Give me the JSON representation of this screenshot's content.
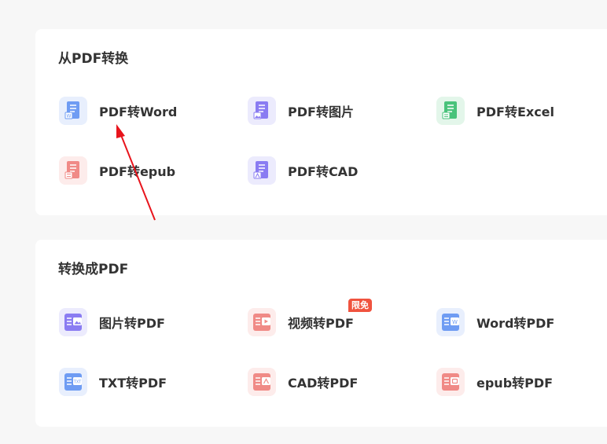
{
  "sections": [
    {
      "title": "从PDF转换",
      "tools": [
        {
          "label": "PDF转Word",
          "icon": "word-doc-icon",
          "color": "#6f9cf3",
          "bg": "#e8effd"
        },
        {
          "label": "PDF转图片",
          "icon": "image-doc-icon",
          "color": "#8a7cf2",
          "bg": "#ecebfd"
        },
        {
          "label": "PDF转Excel",
          "icon": "excel-doc-icon",
          "color": "#49c37b",
          "bg": "#e3f6ea"
        },
        {
          "label": "PDF转epub",
          "icon": "epub-doc-icon",
          "color": "#f08a86",
          "bg": "#fdeceb"
        },
        {
          "label": "PDF转CAD",
          "icon": "cad-doc-icon",
          "color": "#8a7cf2",
          "bg": "#ecebfd"
        }
      ]
    },
    {
      "title": "转换成PDF",
      "tools": [
        {
          "label": "图片转PDF",
          "icon": "image-to-pdf-icon",
          "color": "#8a7cf2",
          "bg": "#ecebfd"
        },
        {
          "label": "视频转PDF",
          "icon": "video-to-pdf-icon",
          "color": "#f08a86",
          "bg": "#fdeceb",
          "badge": "限免"
        },
        {
          "label": "Word转PDF",
          "icon": "word-to-pdf-icon",
          "color": "#6f9cf3",
          "bg": "#e8effd"
        },
        {
          "label": "TXT转PDF",
          "icon": "txt-to-pdf-icon",
          "color": "#6f9cf3",
          "bg": "#e8effd"
        },
        {
          "label": "CAD转PDF",
          "icon": "cad-to-pdf-icon",
          "color": "#f08a86",
          "bg": "#fdeceb"
        },
        {
          "label": "epub转PDF",
          "icon": "epub-to-pdf-icon",
          "color": "#f08a86",
          "bg": "#fdeceb"
        }
      ]
    }
  ],
  "annotation": {
    "arrow_color": "#e8141c"
  }
}
